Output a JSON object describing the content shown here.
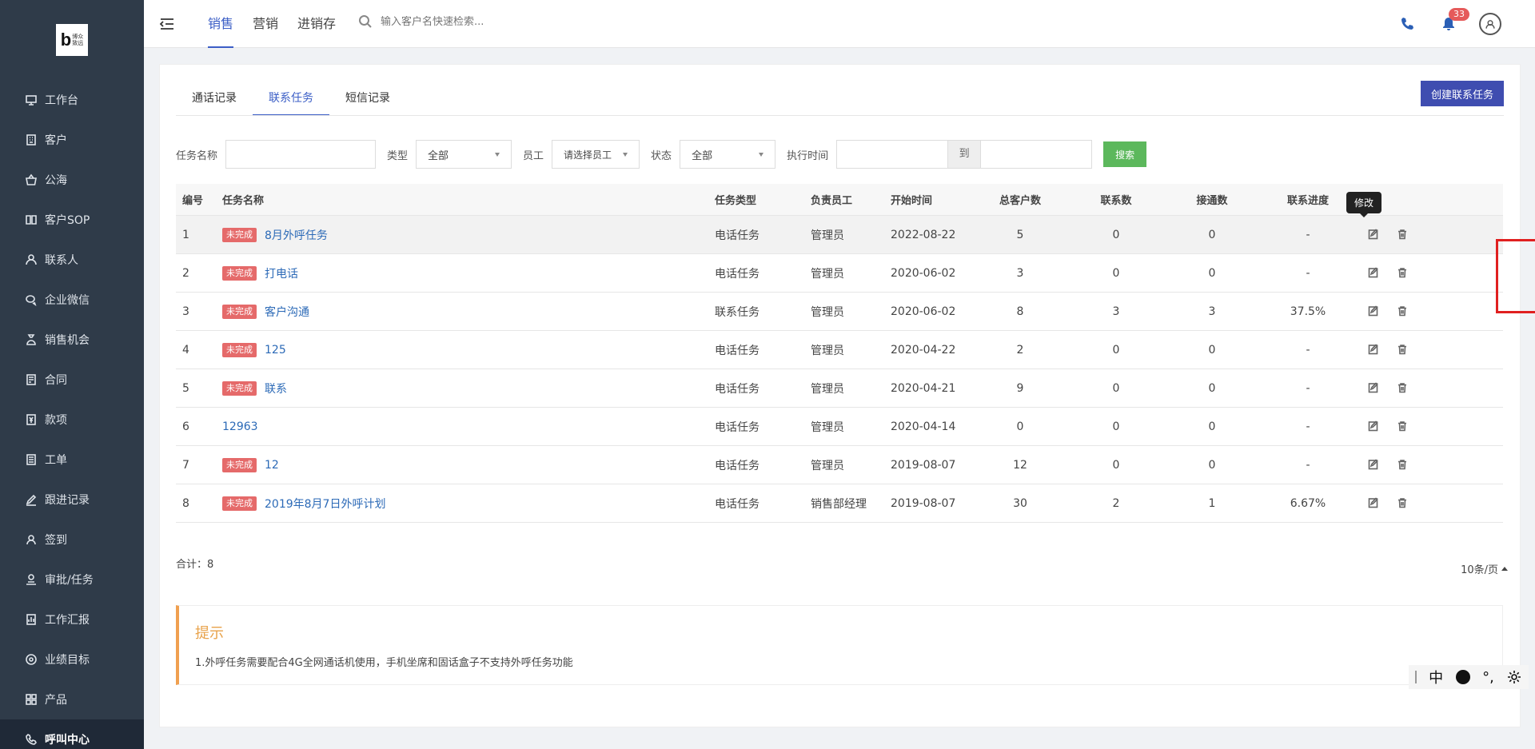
{
  "brand": {
    "logo_letter": "b",
    "logo_text_1": "博众",
    "logo_text_2": "致远"
  },
  "sidebar": {
    "items": [
      {
        "label": "工作台",
        "icon": "desktop-icon"
      },
      {
        "label": "客户",
        "icon": "building-icon"
      },
      {
        "label": "公海",
        "icon": "basket-icon"
      },
      {
        "label": "客户SOP",
        "icon": "sop-icon"
      },
      {
        "label": "联系人",
        "icon": "contact-icon"
      },
      {
        "label": "企业微信",
        "icon": "wechat-icon"
      },
      {
        "label": "销售机会",
        "icon": "money-bag-icon"
      },
      {
        "label": "合同",
        "icon": "contract-icon"
      },
      {
        "label": "款项",
        "icon": "payment-icon"
      },
      {
        "label": "工单",
        "icon": "ticket-icon"
      },
      {
        "label": "跟进记录",
        "icon": "edit-icon"
      },
      {
        "label": "签到",
        "icon": "location-icon"
      },
      {
        "label": "审批/任务",
        "icon": "approval-icon"
      },
      {
        "label": "工作汇报",
        "icon": "report-icon"
      },
      {
        "label": "业绩目标",
        "icon": "target-icon"
      },
      {
        "label": "产品",
        "icon": "grid-icon"
      },
      {
        "label": "呼叫中心",
        "icon": "phone-icon",
        "active": true
      }
    ]
  },
  "header": {
    "tabs": [
      {
        "label": "销售",
        "active": true
      },
      {
        "label": "营销"
      },
      {
        "label": "进销存"
      }
    ],
    "search_placeholder": "输入客户名快速检索...",
    "notification_count": "33"
  },
  "content": {
    "sub_tabs": [
      {
        "label": "通话记录"
      },
      {
        "label": "联系任务",
        "active": true
      },
      {
        "label": "短信记录"
      }
    ],
    "create_button": "创建联系任务",
    "filters": {
      "task_name_label": "任务名称",
      "type_label": "类型",
      "type_value": "全部",
      "staff_label": "员工",
      "staff_value": "请选择员工",
      "status_label": "状态",
      "status_value": "全部",
      "time_label": "执行时间",
      "to_label": "到",
      "search_button": "搜索"
    },
    "table": {
      "headers": [
        "编号",
        "任务名称",
        "任务类型",
        "负责员工",
        "开始时间",
        "总客户数",
        "联系数",
        "接通数",
        "联系进度"
      ],
      "rows": [
        {
          "no": "1",
          "status": "未完成",
          "name": "8月外呼任务",
          "type": "电话任务",
          "owner": "管理员",
          "start": "2022-08-22",
          "total": "5",
          "contact": "0",
          "connected": "0",
          "progress": "-"
        },
        {
          "no": "2",
          "status": "未完成",
          "name": "打电话",
          "type": "电话任务",
          "owner": "管理员",
          "start": "2020-06-02",
          "total": "3",
          "contact": "0",
          "connected": "0",
          "progress": "-"
        },
        {
          "no": "3",
          "status": "未完成",
          "name": "客户沟通",
          "type": "联系任务",
          "owner": "管理员",
          "start": "2020-06-02",
          "total": "8",
          "contact": "3",
          "connected": "3",
          "progress": "37.5%"
        },
        {
          "no": "4",
          "status": "未完成",
          "name": "125",
          "type": "电话任务",
          "owner": "管理员",
          "start": "2020-04-22",
          "total": "2",
          "contact": "0",
          "connected": "0",
          "progress": "-"
        },
        {
          "no": "5",
          "status": "未完成",
          "name": "联系",
          "type": "电话任务",
          "owner": "管理员",
          "start": "2020-04-21",
          "total": "9",
          "contact": "0",
          "connected": "0",
          "progress": "-"
        },
        {
          "no": "6",
          "status": "",
          "name": "12963",
          "type": "电话任务",
          "owner": "管理员",
          "start": "2020-04-14",
          "total": "0",
          "contact": "0",
          "connected": "0",
          "progress": "-"
        },
        {
          "no": "7",
          "status": "未完成",
          "name": "12",
          "type": "电话任务",
          "owner": "管理员",
          "start": "2019-08-07",
          "total": "12",
          "contact": "0",
          "connected": "0",
          "progress": "-"
        },
        {
          "no": "8",
          "status": "未完成",
          "name": "2019年8月7日外呼计划",
          "type": "电话任务",
          "owner": "销售部经理",
          "start": "2019-08-07",
          "total": "30",
          "contact": "2",
          "connected": "1",
          "progress": "6.67%"
        }
      ]
    },
    "tooltip": "修改",
    "total_text": "合计：8",
    "page_size": "10条/页",
    "tip": {
      "title": "提示",
      "body": "1.外呼任务需要配合4G全网通话机使用，手机坐席和固话盒子不支持外呼任务功能"
    }
  },
  "ime": {
    "lang": "中",
    "punct": "°,"
  }
}
